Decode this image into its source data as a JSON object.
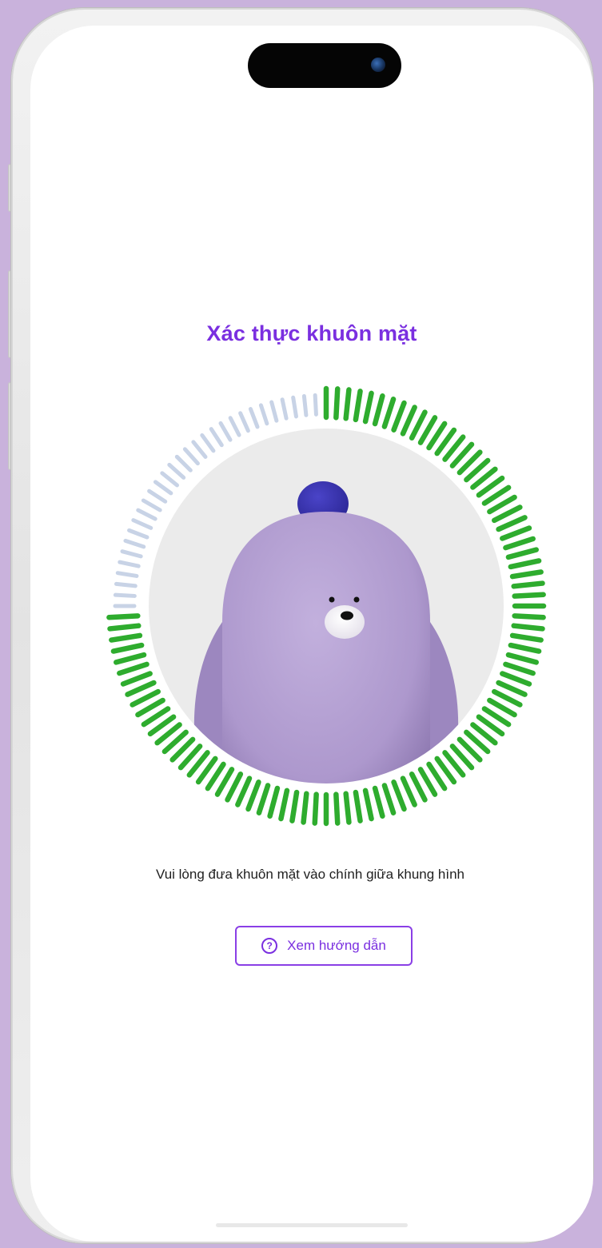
{
  "screen": {
    "title": "Xác thực khuôn mặt",
    "instruction": "Vui lòng đưa khuôn mặt vào chính giữa khung hình",
    "guide_button": {
      "label": "Xem hướng dẫn",
      "icon": "question-circle-icon"
    }
  },
  "face_scan": {
    "progress": 0.75,
    "progress_color": "#2eac2e",
    "remaining_color": "#c8d3e6",
    "character": "purple-bear-mascot"
  },
  "colors": {
    "accent": "#7a2fe0",
    "background": "#c9b2dc"
  }
}
